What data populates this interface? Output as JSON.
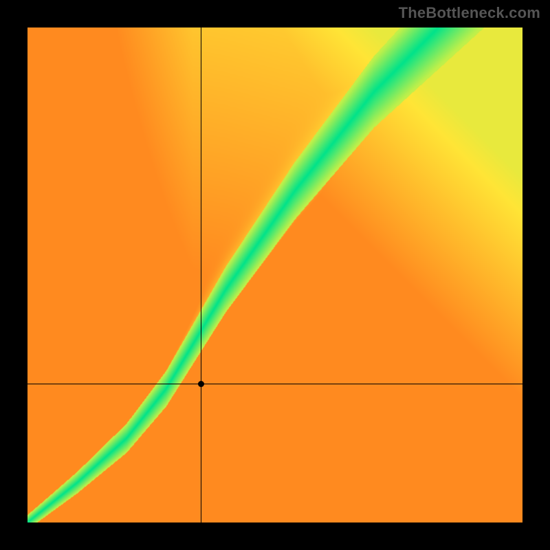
{
  "watermark": "TheBottleneck.com",
  "chart_data": {
    "type": "heatmap",
    "title": "",
    "xlabel": "",
    "ylabel": "",
    "xlim": [
      0,
      1
    ],
    "ylim": [
      0,
      1
    ],
    "colormap_note": "value 0→red, 0.5→yellow, 1→green; green ridge along a diagonal curve",
    "crosshair": {
      "x": 0.35,
      "y": 0.28
    },
    "point": {
      "x": 0.35,
      "y": 0.28
    },
    "ridge": {
      "note": "approximate green ridge center path, normalized coords (0,0)=bottom-left",
      "points": [
        [
          0.0,
          0.0
        ],
        [
          0.1,
          0.08
        ],
        [
          0.2,
          0.17
        ],
        [
          0.28,
          0.27
        ],
        [
          0.34,
          0.37
        ],
        [
          0.4,
          0.47
        ],
        [
          0.47,
          0.57
        ],
        [
          0.54,
          0.67
        ],
        [
          0.62,
          0.77
        ],
        [
          0.7,
          0.87
        ],
        [
          0.8,
          0.97
        ],
        [
          0.83,
          1.0
        ]
      ],
      "width_start": 0.015,
      "width_end": 0.1
    },
    "secondary_ridge": {
      "note": "faint yellow secondary diagonal offset to the right",
      "points": [
        [
          0.2,
          0.18
        ],
        [
          0.35,
          0.3
        ],
        [
          0.55,
          0.48
        ],
        [
          0.75,
          0.68
        ],
        [
          0.95,
          0.88
        ],
        [
          1.0,
          0.93
        ]
      ]
    }
  }
}
